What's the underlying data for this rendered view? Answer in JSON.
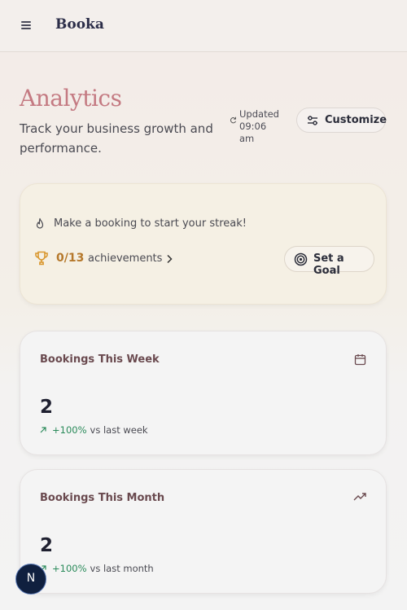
{
  "header": {
    "brand": "Booka",
    "menu_icon": "hamburger-menu-icon"
  },
  "page": {
    "title": "Analytics",
    "subtitle": "Track your business growth and performance.",
    "updated_label": "Updated",
    "updated_time": "09:06 am",
    "customize_label": "Customize"
  },
  "streak": {
    "message": "Make a booking to start your streak!",
    "achievements_count": "0/13",
    "achievements_label": "achievements",
    "goal_button": "Set a Goal"
  },
  "stats": [
    {
      "title": "Bookings This Week",
      "icon": "calendar-icon",
      "value": "2",
      "change": "+100%",
      "compare": "vs last week"
    },
    {
      "title": "Bookings This Month",
      "icon": "trending-up-icon",
      "value": "2",
      "change": "+100%",
      "compare": "vs last month"
    }
  ],
  "user": {
    "avatar_initial": "N"
  },
  "colors": {
    "accent_title": "#c47a82",
    "positive": "#2a8a5a",
    "trophy": "#d9962c"
  }
}
